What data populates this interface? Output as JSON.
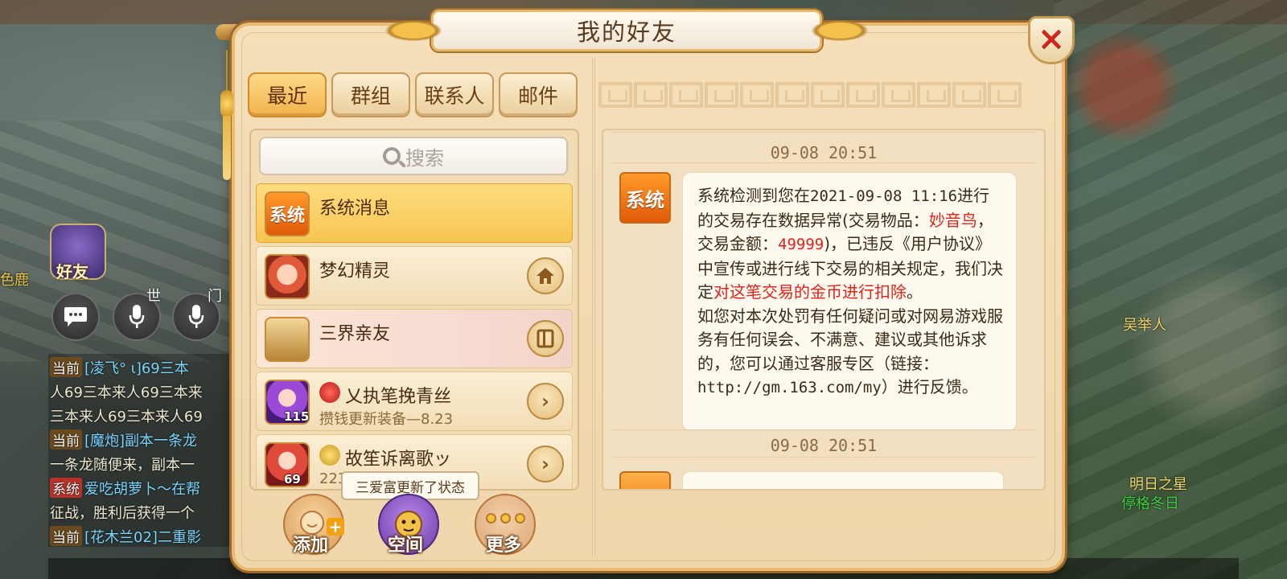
{
  "dialog": {
    "title": "我的好友",
    "tabs": [
      {
        "label": "最近",
        "active": true
      },
      {
        "label": "群组",
        "active": false
      },
      {
        "label": "联系人",
        "active": false
      },
      {
        "label": "邮件",
        "active": false
      }
    ],
    "search": {
      "placeholder": "搜索"
    },
    "friends": [
      {
        "name": "系统消息",
        "avatar_text": "系统",
        "subtitle": "",
        "level": "",
        "action_icon": ""
      },
      {
        "name": "梦幻精灵",
        "avatar_text": "",
        "subtitle": "",
        "level": "",
        "action_icon": "home-icon"
      },
      {
        "name": "三界亲友",
        "avatar_text": "",
        "subtitle": "",
        "level": "",
        "action_icon": "book-icon"
      },
      {
        "name": "乂执笔挽青丝",
        "avatar_text": "",
        "subtitle": "攒钱更新装备—8.23",
        "level": "115",
        "action_icon": "chevron-right-icon"
      },
      {
        "name": "故笙诉离歌ッ",
        "avatar_text": "",
        "subtitle": "223",
        "level": "69",
        "action_icon": "chevron-right-icon"
      }
    ],
    "tooltip": "三爱富更新了状态",
    "bottom_buttons": [
      {
        "label": "添加"
      },
      {
        "label": "空间"
      },
      {
        "label": "更多"
      }
    ],
    "chat": {
      "timestamps": [
        "09-08 20:51",
        "09-08 20:51"
      ],
      "sender_avatar_text": "系统",
      "message": {
        "p1_a": "系统检测到您在",
        "p1_date": "2021-09-08 11:16",
        "p1_b": "进行的交易存在数据异常(交易物品：",
        "item": "妙音鸟",
        "p1_c": "，交易金额：",
        "amount": "49999",
        "p1_d": ")，已违反《用户协议》中宣传或进行线下交易的相关规定，我们决定",
        "penalty": "对这笔交易的金币进行扣除",
        "p1_e": "。",
        "p2": "如您对本次处罚有任何疑问或对网易游戏服务有任何误会、不满意、建议或其他诉求的，您可以通过客服专区（链接：",
        "link": "http://gm.163.com/my",
        "p2_end": "）进行反馈。"
      }
    }
  },
  "hud": {
    "friend_button_label": "好友",
    "player_name_left": "色鹿",
    "voice_labels": [
      "世",
      "门"
    ],
    "chat_lines": [
      {
        "tag": "当前",
        "text": "[凌飞° ι]69三本"
      },
      {
        "tag": "",
        "text": "人69三本来人69三本来"
      },
      {
        "tag": "",
        "text": "三本来人69三本来人69"
      },
      {
        "tag": "当前",
        "text": "[魔炮]副本一条龙"
      },
      {
        "tag": "",
        "text": "一条龙随便来，副本一"
      },
      {
        "tag": "系统",
        "text": "爱吃胡萝卜～在帮"
      },
      {
        "tag": "",
        "text": "征战，胜利后获得一个"
      },
      {
        "tag": "当前",
        "text": "[花木兰02]二重影"
      }
    ],
    "npc_names": [
      "吴举人",
      "明日之星",
      "停格冬日"
    ]
  }
}
